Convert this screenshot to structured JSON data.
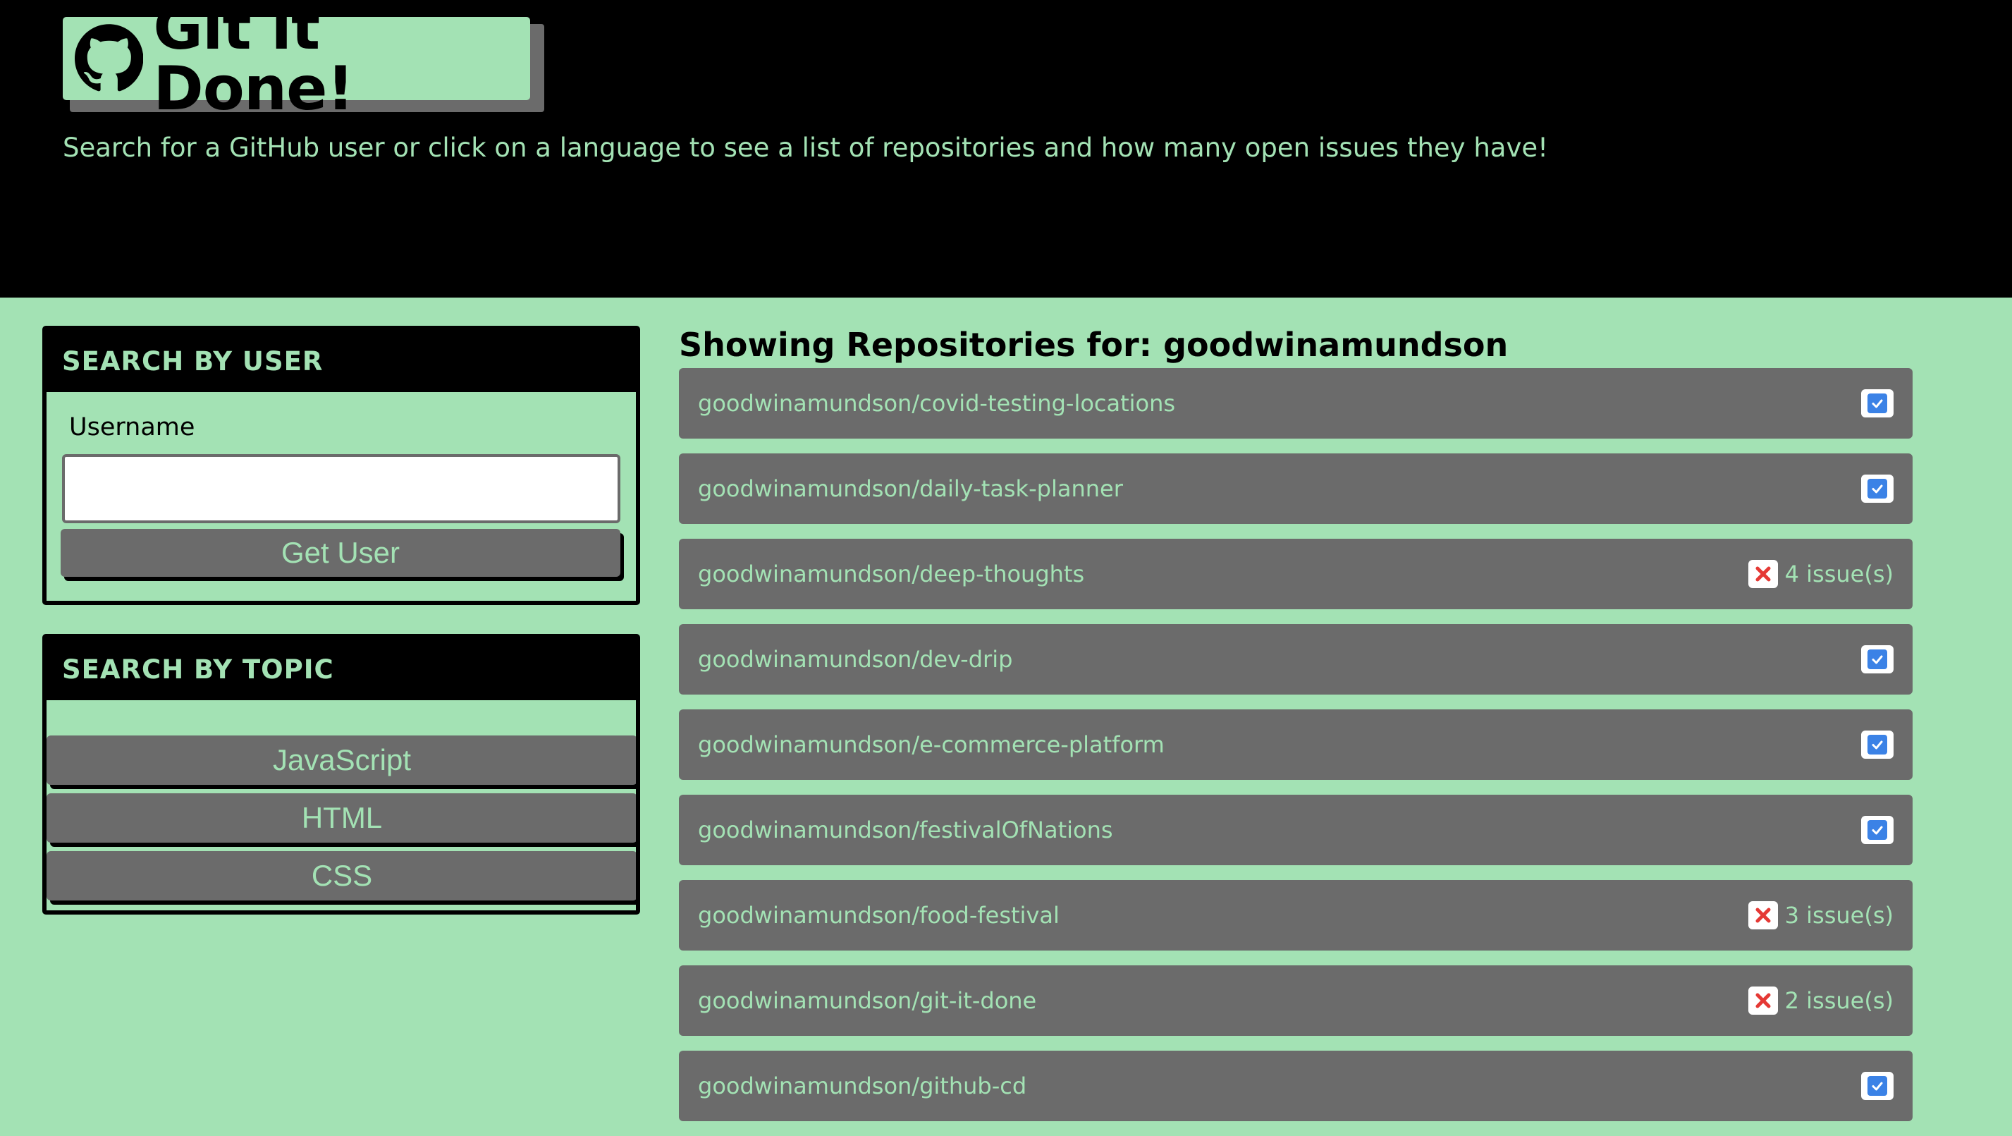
{
  "header": {
    "title": "Git it Done!",
    "subtitle": "Search for a GitHub user or click on a language to see a list of repositories and how many open issues they have!"
  },
  "user_search": {
    "heading": "SEARCH BY USER",
    "username_label": "Username",
    "username_value": "",
    "button_label": "Get User"
  },
  "topic_search": {
    "heading": "SEARCH BY TOPIC",
    "languages": [
      "JavaScript",
      "HTML",
      "CSS"
    ]
  },
  "repos": {
    "heading": "Showing Repositories for: goodwinamundson",
    "items": [
      {
        "name": "goodwinamundson/covid-testing-locations",
        "status": "check-icon",
        "issues": ""
      },
      {
        "name": "goodwinamundson/daily-task-planner",
        "status": "check-icon",
        "issues": ""
      },
      {
        "name": "goodwinamundson/deep-thoughts",
        "status": "x-icon",
        "issues": "4 issue(s)"
      },
      {
        "name": "goodwinamundson/dev-drip",
        "status": "check-icon",
        "issues": ""
      },
      {
        "name": "goodwinamundson/e-commerce-platform",
        "status": "check-icon",
        "issues": ""
      },
      {
        "name": "goodwinamundson/festivalOfNations",
        "status": "check-icon",
        "issues": ""
      },
      {
        "name": "goodwinamundson/food-festival",
        "status": "x-icon",
        "issues": "3 issue(s)"
      },
      {
        "name": "goodwinamundson/git-it-done",
        "status": "x-icon",
        "issues": "2 issue(s)"
      },
      {
        "name": "goodwinamundson/github-cd",
        "status": "check-icon",
        "issues": ""
      }
    ]
  },
  "colors": {
    "accent_green": "#a3e2b4",
    "panel_gray": "#6b6b6b",
    "check_blue": "#3b82e6",
    "x_red": "#e53935"
  }
}
